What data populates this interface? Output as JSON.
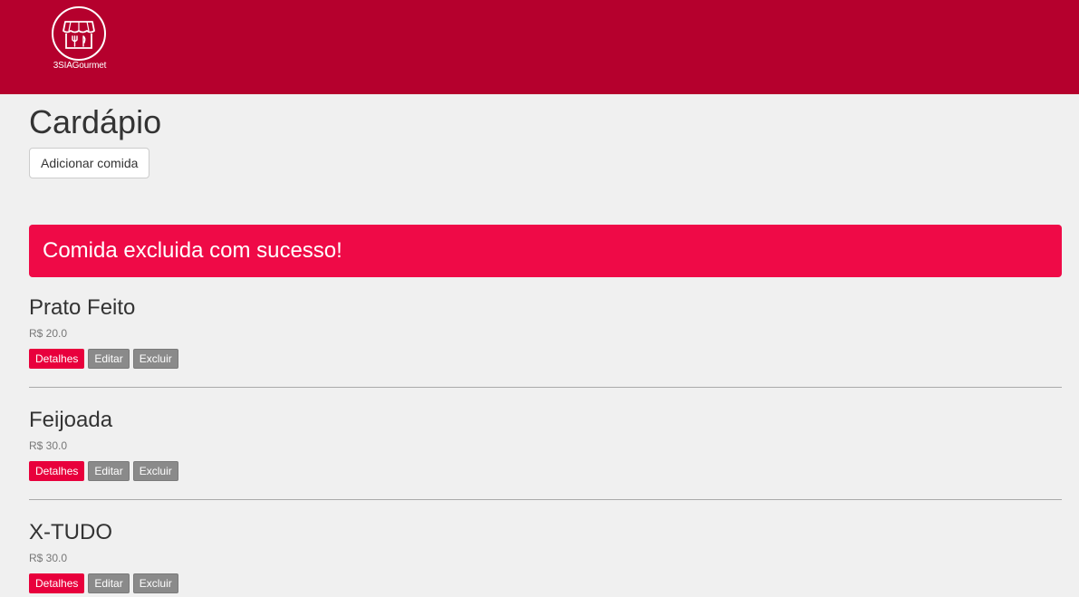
{
  "brand": {
    "name": "3SIAGourmet",
    "logo_icon": "restaurant-storefront-icon"
  },
  "page": {
    "title": "Cardápio",
    "add_button": "Adicionar comida"
  },
  "alert": {
    "message": "Comida excluida com sucesso!"
  },
  "actions": {
    "details": "Detalhes",
    "edit": "Editar",
    "delete": "Excluir"
  },
  "items": [
    {
      "name": "Prato Feito",
      "price": "R$ 20.0"
    },
    {
      "name": "Feijoada",
      "price": "R$ 30.0"
    },
    {
      "name": "X-TUDO",
      "price": "R$ 30.0"
    }
  ],
  "colors": {
    "header": "#b5002d",
    "alert": "#ef0a47",
    "primary_button": "#e8003c",
    "secondary_button": "#8a8a8a"
  }
}
